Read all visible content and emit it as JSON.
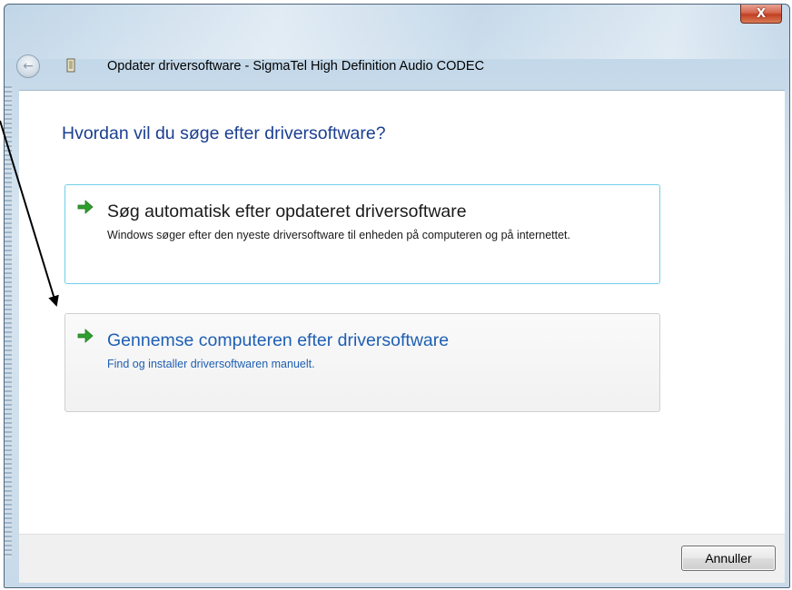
{
  "window": {
    "title": "Opdater driversoftware  - SigmaTel High Definition Audio CODEC",
    "close_label": "X"
  },
  "content": {
    "question": "Hvordan vil du søge efter driversoftware?",
    "options": [
      {
        "title": "Søg automatisk efter opdateret driversoftware",
        "description": "Windows søger efter den nyeste driversoftware til enheden på computeren og på internettet."
      },
      {
        "title": "Gennemse computeren efter driversoftware",
        "description": "Find og installer driversoftwaren manuelt."
      }
    ]
  },
  "footer": {
    "cancel_label": "Annuller"
  },
  "icons": {
    "back": "back-arrow-icon",
    "driver": "driver-device-icon",
    "option_arrow": "green-arrow-icon"
  },
  "colors": {
    "question": "#1b3f91",
    "link_text": "#1e5fb3",
    "arrow_green": "#2e9e2e",
    "hover_border": "#6fcfea",
    "close_red": "#c13f22"
  }
}
